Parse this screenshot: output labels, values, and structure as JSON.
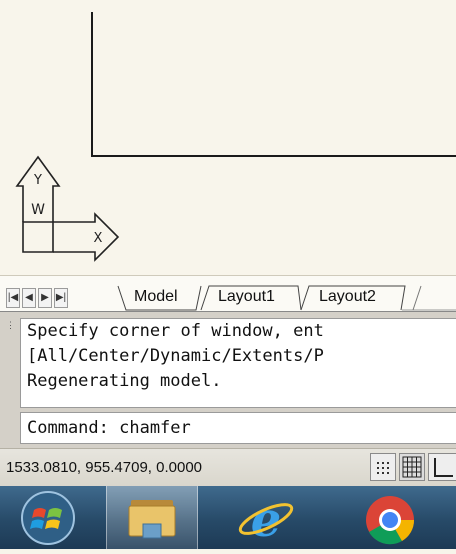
{
  "canvas": {
    "ucs_icon": {
      "y_label": "Y",
      "w_label": "W",
      "x_label": "X"
    }
  },
  "layout_tabs": {
    "tabs": [
      {
        "label": "Model",
        "active": true
      },
      {
        "label": "Layout1",
        "active": false
      },
      {
        "label": "Layout2",
        "active": false
      }
    ]
  },
  "command_window": {
    "history": [
      "Specify corner of window, ent",
      "[All/Center/Dynamic/Extents/P",
      "Regenerating model."
    ],
    "prompt": "Command: chamfer"
  },
  "status_bar": {
    "coordinates": "1533.0810, 955.4709, 0.0000",
    "buttons": [
      "snap-mode-icon",
      "grid-display-icon",
      "ortho-mode-icon"
    ]
  },
  "taskbar": {
    "items": [
      "windows-start-icon",
      "file-explorer-icon",
      "internet-explorer-icon",
      "chrome-icon"
    ]
  }
}
